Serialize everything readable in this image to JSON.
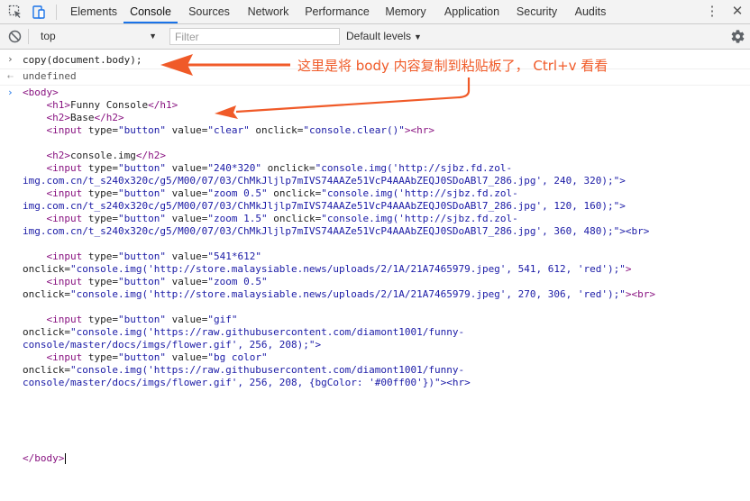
{
  "devtools": {
    "tabs": [
      {
        "label": "Elements",
        "active": false
      },
      {
        "label": "Console",
        "active": true
      },
      {
        "label": "Sources",
        "active": false
      },
      {
        "label": "Network",
        "active": false
      },
      {
        "label": "Performance",
        "active": false
      },
      {
        "label": "Memory",
        "active": false
      },
      {
        "label": "Application",
        "active": false
      },
      {
        "label": "Security",
        "active": false
      },
      {
        "label": "Audits",
        "active": false
      }
    ],
    "accent_color": "#1a73e8"
  },
  "toolbar": {
    "context": "top",
    "filter_placeholder": "Filter",
    "filter_value": "",
    "levels_label": "Default levels"
  },
  "console": {
    "command": "copy(document.body);",
    "result": "undefined",
    "html_lines": [
      "<body>",
      "    <h1>Funny Console</h1>",
      "    <h2>Base</h2>",
      "    <input type=\"button\" value=\"clear\" onclick=\"console.clear()\"><hr>",
      "",
      "    <h2>console.img</h2>",
      "    <input type=\"button\" value=\"240*320\" onclick=\"console.img('http://sjbz.fd.zol-",
      "img.com.cn/t_s240x320c/g5/M00/07/03/ChMkJljlp7mIVS74AAZe51VcP4AAAbZEQJ0SDoABl7_286.jpg', 240, 320);\">",
      "    <input type=\"button\" value=\"zoom 0.5\" onclick=\"console.img('http://sjbz.fd.zol-",
      "img.com.cn/t_s240x320c/g5/M00/07/03/ChMkJljlp7mIVS74AAZe51VcP4AAAbZEQJ0SDoABl7_286.jpg', 120, 160);\">",
      "    <input type=\"button\" value=\"zoom 1.5\" onclick=\"console.img('http://sjbz.fd.zol-",
      "img.com.cn/t_s240x320c/g5/M00/07/03/ChMkJljlp7mIVS74AAZe51VcP4AAAbZEQJ0SDoABl7_286.jpg', 360, 480);\"><br>",
      "",
      "    <input type=\"button\" value=\"541*612\"",
      "onclick=\"console.img('http://store.malaysiable.news/uploads/2/1A/21A7465979.jpeg', 541, 612, 'red');\">",
      "    <input type=\"button\" value=\"zoom 0.5\"",
      "onclick=\"console.img('http://store.malaysiable.news/uploads/2/1A/21A7465979.jpeg', 270, 306, 'red');\"><br>",
      "",
      "    <input type=\"button\" value=\"gif\"",
      "onclick=\"console.img('https://raw.githubusercontent.com/diamont1001/funny-",
      "console/master/docs/imgs/flower.gif', 256, 208);\">",
      "    <input type=\"button\" value=\"bg color\"",
      "onclick=\"console.img('https://raw.githubusercontent.com/diamont1001/funny-",
      "console/master/docs/imgs/flower.gif', 256, 208, {bgColor: '#00ff00'})\"><hr>",
      "",
      "",
      "",
      "",
      "",
      "</body>"
    ]
  },
  "annotation": {
    "text": "这里是将 body 内容复制到粘贴板了， Ctrl+v 看看",
    "color": "#f05a28"
  }
}
